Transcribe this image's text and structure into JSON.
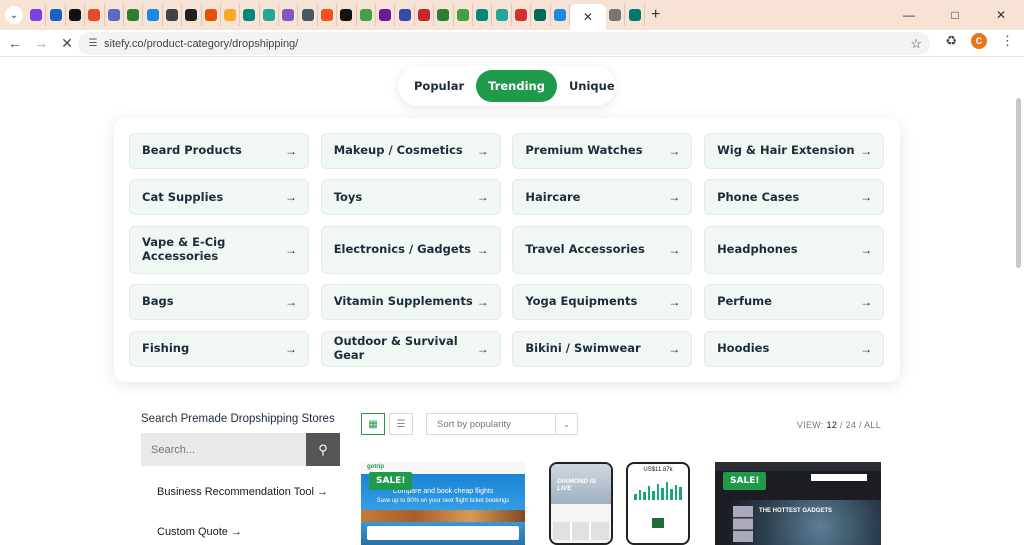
{
  "browser": {
    "url": "sitefy.co/product-category/dropshipping/",
    "profile_initial": "C",
    "favicon_colors": [
      "#7b3fe4",
      "#1565c0",
      "#111111",
      "#e34c26",
      "#5c6bc0",
      "#2e7d32",
      "#1e88e5",
      "#424242",
      "#212121",
      "#e65100",
      "#f9a825",
      "#00897b",
      "#26a69a",
      "#7e57c2",
      "#455a64",
      "#f4511e",
      "#111111",
      "#43a047",
      "#6a1b9a",
      "#3949ab",
      "#c62828",
      "#2e7d32",
      "#43a047",
      "#00897b",
      "#26a69a",
      "#d32f2f",
      "#00695c",
      "#1e88e5",
      "#757575",
      "#00796b"
    ],
    "icons": {
      "tab_dropdown": "chevron-down-icon",
      "back": "arrow-left-icon",
      "forward": "arrow-right-icon",
      "reload": "close-icon",
      "site_info": "tune-icon",
      "bookmark": "star-icon",
      "extensions": "puzzle-icon",
      "menu": "kebab-icon",
      "new_tab": "plus-icon"
    }
  },
  "filters": {
    "tabs": [
      {
        "label": "Popular",
        "active": false
      },
      {
        "label": "Trending",
        "active": true
      },
      {
        "label": "Unique",
        "active": false
      }
    ]
  },
  "categories": [
    {
      "label": "Beard Products"
    },
    {
      "label": "Makeup / Cosmetics"
    },
    {
      "label": "Premium Watches"
    },
    {
      "label": "Wig & Hair Extension"
    },
    {
      "label": "Cat Supplies"
    },
    {
      "label": "Toys"
    },
    {
      "label": "Haircare"
    },
    {
      "label": "Phone Cases"
    },
    {
      "label": "Vape & E-Cig Accessories"
    },
    {
      "label": "Electronics / Gadgets"
    },
    {
      "label": "Travel Accessories"
    },
    {
      "label": "Headphones"
    },
    {
      "label": "Bags"
    },
    {
      "label": "Vitamin Supplements"
    },
    {
      "label": "Yoga Equipments"
    },
    {
      "label": "Perfume"
    },
    {
      "label": "Fishing"
    },
    {
      "label": "Outdoor & Survival Gear"
    },
    {
      "label": "Bikini / Swimwear"
    },
    {
      "label": "Hoodies"
    }
  ],
  "sidebar": {
    "search_title_prefix": "Search",
    "search_title_rest": "Premade Dropshipping Stores",
    "search_placeholder": "Search...",
    "links": [
      {
        "label": "Business Recommendation Tool →"
      },
      {
        "label": "Custom Quote →"
      }
    ]
  },
  "shop_toolbar": {
    "sort_value": "Sort by popularity",
    "view_label": "VIEW:",
    "view_current": "12",
    "view_options": "/ 24 / ALL"
  },
  "products": [
    {
      "badge": "SALE!",
      "brand": "gotrip",
      "headline": "Compare and book cheap flights",
      "subline": "Save up to 80% on your next flight ticket bookings"
    },
    {
      "badge": "",
      "tagline": "DIAMOND IS LIVE",
      "stat": "US$11.87k"
    },
    {
      "badge": "SALE!",
      "headline": "THE HOTTEST GADGETS"
    }
  ]
}
